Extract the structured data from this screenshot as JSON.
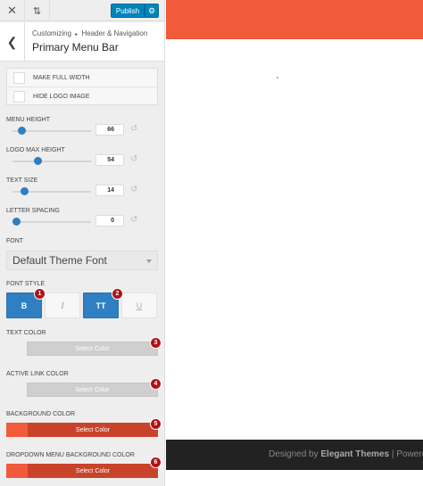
{
  "topbar": {
    "close_icon": "close-icon",
    "reorder_icon": "arrows-up-down-icon",
    "publish_label": "Publish",
    "gear_icon": "gear-icon"
  },
  "header": {
    "breadcrumb_parent": "Customizing",
    "breadcrumb_sep": "▸",
    "breadcrumb_section": "Header & Navigation",
    "title": "Primary Menu Bar"
  },
  "checkboxes": [
    {
      "label": "MAKE FULL WIDTH",
      "checked": false
    },
    {
      "label": "HIDE LOGO IMAGE",
      "checked": false
    }
  ],
  "sliders": [
    {
      "label": "MENU HEIGHT",
      "value": "66",
      "fraction": 0.08
    },
    {
      "label": "LOGO MAX HEIGHT",
      "value": "54",
      "fraction": 0.31
    },
    {
      "label": "TEXT SIZE",
      "value": "14",
      "fraction": 0.12
    },
    {
      "label": "LETTER SPACING",
      "value": "0",
      "fraction": 0.0
    }
  ],
  "font": {
    "label": "FONT",
    "selected": "Default Theme Font"
  },
  "font_style": {
    "label": "FONT STYLE",
    "buttons": [
      {
        "label": "B",
        "active": true
      },
      {
        "label": "I",
        "active": false
      },
      {
        "label": "TT",
        "active": true
      },
      {
        "label": "U",
        "active": false
      }
    ]
  },
  "colors": [
    {
      "label": "TEXT COLOR",
      "button": "Select Color",
      "swatch": ""
    },
    {
      "label": "ACTIVE LINK COLOR",
      "button": "Select Color",
      "swatch": ""
    },
    {
      "label": "BACKGROUND COLOR",
      "button": "Select Color",
      "swatch": "#f15a3a"
    },
    {
      "label": "DROPDOWN MENU BACKGROUND COLOR",
      "button": "Select Color",
      "swatch": "#f15a3a"
    }
  ],
  "markers": [
    "1",
    "2",
    "3",
    "4",
    "5",
    "6"
  ],
  "preview": {
    "menu_bar_color": "#f15a3a",
    "footer_prefix": "Designed by",
    "footer_brand": "Elegant Themes",
    "footer_rest": " | Powered"
  }
}
